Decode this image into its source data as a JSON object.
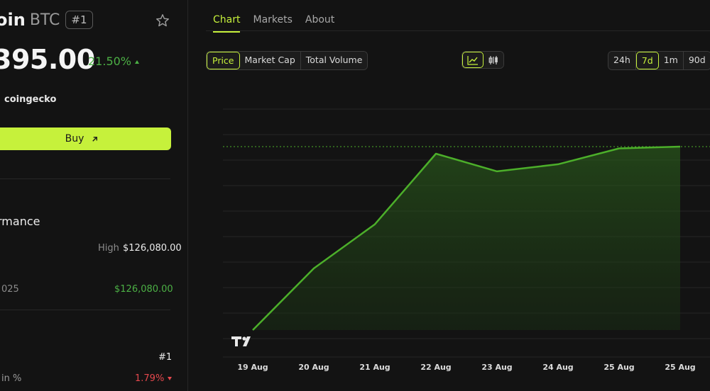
{
  "coin": {
    "name": "oin",
    "symbol": "BTC",
    "rank": "#1",
    "price": "395.00",
    "change": "21.50%",
    "source": "coingecko",
    "buy_label": "Buy"
  },
  "performance": {
    "title": "rmance",
    "high_label": "High",
    "high_value": "$126,080.00",
    "ath_date_label": "025",
    "ath_value": "$126,080.00",
    "rank_value": "#1",
    "pct_label": "in %",
    "pct_value": "1.79%"
  },
  "tabs": [
    "Chart",
    "Markets",
    "About"
  ],
  "metric_options": [
    "Price",
    "Market Cap",
    "Total Volume"
  ],
  "time_options": [
    "24h",
    "7d",
    "1m",
    "90d"
  ],
  "colors": {
    "accent": "#c6f13b",
    "up": "#4cb045",
    "down": "#e5484d",
    "line": "#4caf2a"
  },
  "chart_data": {
    "type": "area",
    "x_labels": [
      "19 Aug",
      "20 Aug",
      "21 Aug",
      "22 Aug",
      "23 Aug",
      "24 Aug",
      "25 Aug",
      "25 Aug"
    ],
    "values": [
      0.0,
      0.35,
      0.6,
      1.0,
      0.9,
      0.94,
      1.03,
      1.04
    ],
    "current_value_line": 1.04,
    "grid": true,
    "watermark": "TV"
  }
}
